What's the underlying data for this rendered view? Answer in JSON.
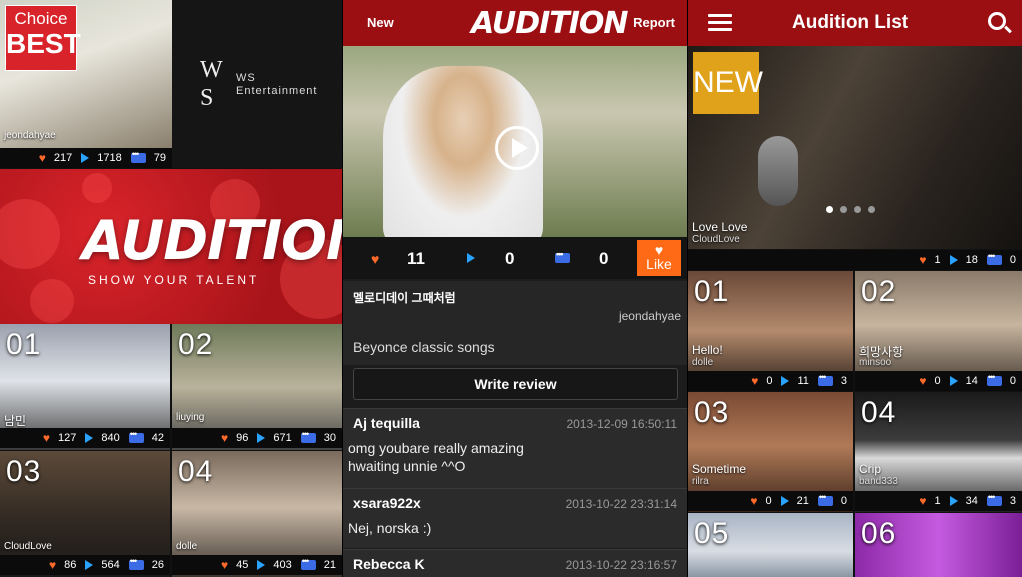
{
  "panel1": {
    "choice": {
      "line1": "Choice",
      "line2": "BEST"
    },
    "featured": {
      "user": "jeondahyae",
      "likes": "217",
      "plays": "1718",
      "comments": "79"
    },
    "sponsor": {
      "logo": "W\nS",
      "name": "WS\nEntertainment"
    },
    "banner": {
      "title": "AUDITION",
      "subtitle": "SHOW YOUR TALENT"
    },
    "items": [
      {
        "num": "01",
        "user": "남민",
        "likes": "127",
        "plays": "840",
        "comments": "42"
      },
      {
        "num": "02",
        "user": "liuying",
        "likes": "96",
        "plays": "671",
        "comments": "30"
      },
      {
        "num": "03",
        "user": "CloudLove",
        "likes": "86",
        "plays": "564",
        "comments": "26"
      },
      {
        "num": "04",
        "user": "dolle",
        "likes": "45",
        "plays": "403",
        "comments": "21"
      }
    ]
  },
  "panel2": {
    "header": {
      "left": "New",
      "title": "AUDITION",
      "right": "Report"
    },
    "stats": {
      "likes": "11",
      "plays": "0",
      "comments": "0"
    },
    "like_button": "Like",
    "song_title": "멜로디데이 그때처럼",
    "user": "jeondahyae",
    "description": "Beyonce classic songs",
    "review_button": "Write review",
    "comments": [
      {
        "name": "Aj tequilla",
        "date": "2013-12-09 16:50:11",
        "text": "omg youbare really amazing\nhwaiting unnie ^^O"
      },
      {
        "name": "xsara922x",
        "date": "2013-10-22 23:31:14",
        "text": "Nej, norska :)"
      },
      {
        "name": "Rebecca K",
        "date": "2013-10-22 23:16:57",
        "text": ""
      }
    ]
  },
  "panel3": {
    "header": {
      "title": "Audition List"
    },
    "hero": {
      "badge": "NEW",
      "title": "Love Love",
      "user": "CloudLove",
      "likes": "1",
      "plays": "18",
      "comments": "0"
    },
    "items": [
      {
        "num": "01",
        "title": "Hello!",
        "user": "dolle",
        "likes": "0",
        "plays": "11",
        "comments": "3"
      },
      {
        "num": "02",
        "title": "희망사항",
        "user": "minsoo",
        "likes": "0",
        "plays": "14",
        "comments": "0"
      },
      {
        "num": "03",
        "title": "Sometime",
        "user": "rilra",
        "likes": "0",
        "plays": "21",
        "comments": "0"
      },
      {
        "num": "04",
        "title": "Crip",
        "user": "band333",
        "likes": "1",
        "plays": "34",
        "comments": "3"
      },
      {
        "num": "05"
      },
      {
        "num": "06"
      }
    ]
  }
}
